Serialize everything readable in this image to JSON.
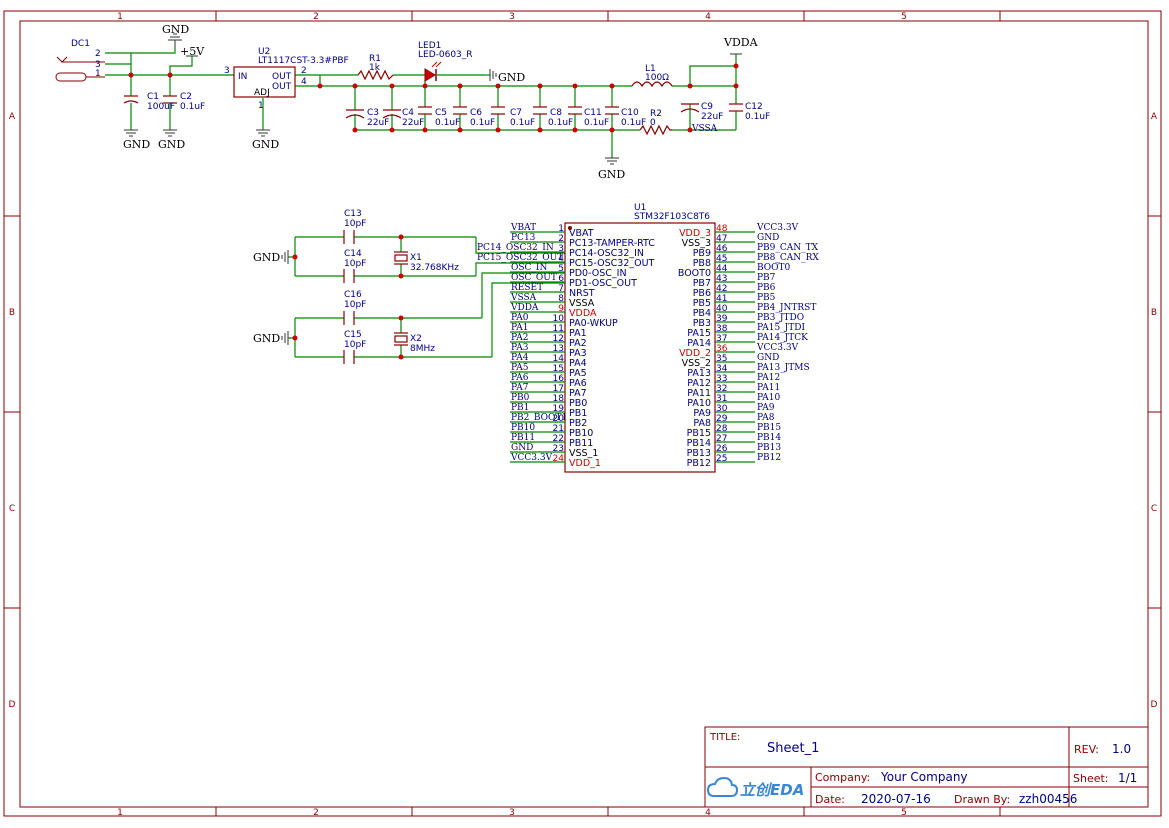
{
  "frame": {
    "columns": [
      "1",
      "2",
      "3",
      "4",
      "5"
    ],
    "rows": [
      "A",
      "B",
      "C",
      "D"
    ]
  },
  "title_block": {
    "title_label": "TITLE:",
    "title": "Sheet_1",
    "rev_label": "REV:",
    "rev": "1.0",
    "company_label": "Company:",
    "company": "Your Company",
    "sheet_label": "Sheet:",
    "sheet": "1/1",
    "date_label": "Date:",
    "date": "2020-07-16",
    "drawn_label": "Drawn By:",
    "drawn": "zzh00456",
    "logo_text": "立创EDA"
  },
  "power": {
    "dc1": {
      "ref": "DC1",
      "pin2": "2",
      "pin3": "3",
      "pin1": "1",
      "sym": "V"
    },
    "gnd": "GND",
    "vcc5": "+5V",
    "vdda": "VDDA",
    "vssa": "VSSA",
    "u2": {
      "ref": "U2",
      "part": "LT1117CST-3.3#PBF",
      "in": "IN",
      "out": "OUT",
      "adj": "ADJ",
      "pin3": "3",
      "pin2": "2",
      "pin4": "4",
      "pin1": "1"
    },
    "r1": {
      "ref": "R1",
      "val": "1k"
    },
    "led1": {
      "ref": "LED1",
      "val": "LED-0603_R"
    },
    "l1": {
      "ref": "L1",
      "val": "100Ω"
    },
    "r2": {
      "ref": "R2",
      "val": "0"
    },
    "caps": [
      {
        "ref": "C1",
        "val": "100uF"
      },
      {
        "ref": "C2",
        "val": "0.1uF"
      },
      {
        "ref": "C3",
        "val": "22uF"
      },
      {
        "ref": "C4",
        "val": "22uF"
      },
      {
        "ref": "C5",
        "val": "0.1uF"
      },
      {
        "ref": "C6",
        "val": "0.1uF"
      },
      {
        "ref": "C7",
        "val": "0.1uF"
      },
      {
        "ref": "C8",
        "val": "0.1uF"
      },
      {
        "ref": "C11",
        "val": "0.1uF"
      },
      {
        "ref": "C10",
        "val": "0.1uF"
      },
      {
        "ref": "C9",
        "val": "22uF"
      },
      {
        "ref": "C12",
        "val": "0.1uF"
      }
    ]
  },
  "osc": {
    "c13": {
      "ref": "C13",
      "val": "10pF"
    },
    "c14": {
      "ref": "C14",
      "val": "10pF"
    },
    "c16": {
      "ref": "C16",
      "val": "10pF"
    },
    "c15": {
      "ref": "C15",
      "val": "10pF"
    },
    "x1": {
      "ref": "X1",
      "val": "32.768KHz"
    },
    "x2": {
      "ref": "X2",
      "val": "8MHz"
    },
    "net_pc14": "PC14_OSC32_IN",
    "net_pc15": "PC15_OSC32_OUT"
  },
  "mcu": {
    "ref": "U1",
    "part": "STM32F103C8T6",
    "left_pins": [
      {
        "num": "1",
        "name": "VBAT",
        "net": "VBAT",
        "red": false
      },
      {
        "num": "2",
        "name": "PC13-TAMPER-RTC",
        "net": "PC13",
        "red": false
      },
      {
        "num": "3",
        "name": "PC14-OSC32_IN",
        "net": "",
        "red": false
      },
      {
        "num": "4",
        "name": "PC15-OSC32_OUT",
        "net": "",
        "red": false
      },
      {
        "num": "5",
        "name": "PD0-OSC_IN",
        "net": "OSC_IN",
        "red": false
      },
      {
        "num": "6",
        "name": "PD1-OSC_OUT",
        "net": "OSC_OUT",
        "red": false
      },
      {
        "num": "7",
        "name": "NRST",
        "net": "RESET",
        "red": false
      },
      {
        "num": "8",
        "name": "VSSA",
        "net": "VSSA",
        "red": false
      },
      {
        "num": "9",
        "name": "VDDA",
        "net": "VDDA",
        "red": true
      },
      {
        "num": "10",
        "name": "PA0-WKUP",
        "net": "PA0",
        "red": false
      },
      {
        "num": "11",
        "name": "PA1",
        "net": "PA1",
        "red": false
      },
      {
        "num": "12",
        "name": "PA2",
        "net": "PA2",
        "red": false
      },
      {
        "num": "13",
        "name": "PA3",
        "net": "PA3",
        "red": false
      },
      {
        "num": "14",
        "name": "PA4",
        "net": "PA4",
        "red": false
      },
      {
        "num": "15",
        "name": "PA5",
        "net": "PA5",
        "red": false
      },
      {
        "num": "16",
        "name": "PA6",
        "net": "PA6",
        "red": false
      },
      {
        "num": "17",
        "name": "PA7",
        "net": "PA7",
        "red": false
      },
      {
        "num": "18",
        "name": "PB0",
        "net": "PB0",
        "red": false
      },
      {
        "num": "19",
        "name": "PB1",
        "net": "PB1",
        "red": false
      },
      {
        "num": "20",
        "name": "PB2",
        "net": "PB2_BOOT1",
        "red": false
      },
      {
        "num": "21",
        "name": "PB10",
        "net": "PB10",
        "red": false
      },
      {
        "num": "22",
        "name": "PB11",
        "net": "PB11",
        "red": false
      },
      {
        "num": "23",
        "name": "VSS_1",
        "net": "GND",
        "red": false
      },
      {
        "num": "24",
        "name": "VDD_1",
        "net": "VCC3.3V",
        "red": true
      }
    ],
    "right_pins": [
      {
        "num": "48",
        "name": "VDD_3",
        "net": "VCC3.3V",
        "red": true
      },
      {
        "num": "47",
        "name": "VSS_3",
        "net": "GND",
        "red": false
      },
      {
        "num": "46",
        "name": "PB9",
        "net": "PB9_CAN_TX",
        "red": false
      },
      {
        "num": "45",
        "name": "PB8",
        "net": "PB8_CAN_RX",
        "red": false
      },
      {
        "num": "44",
        "name": "BOOT0",
        "net": "BOOT0",
        "red": false
      },
      {
        "num": "43",
        "name": "PB7",
        "net": "PB7",
        "red": false
      },
      {
        "num": "42",
        "name": "PB6",
        "net": "PB6",
        "red": false
      },
      {
        "num": "41",
        "name": "PB5",
        "net": "PB5",
        "red": false
      },
      {
        "num": "40",
        "name": "PB4",
        "net": "PB4_JNTRST",
        "red": false
      },
      {
        "num": "39",
        "name": "PB3",
        "net": "PB3_JTDO",
        "red": false
      },
      {
        "num": "38",
        "name": "PA15",
        "net": "PA15_JTDI",
        "red": false
      },
      {
        "num": "37",
        "name": "PA14",
        "net": "PA14_JTCK",
        "red": false
      },
      {
        "num": "36",
        "name": "VDD_2",
        "net": "VCC3.3V",
        "red": true
      },
      {
        "num": "35",
        "name": "VSS_2",
        "net": "GND",
        "red": false
      },
      {
        "num": "34",
        "name": "PA13",
        "net": "PA13_JTMS",
        "red": false
      },
      {
        "num": "33",
        "name": "PA12",
        "net": "PA12",
        "red": false
      },
      {
        "num": "32",
        "name": "PA11",
        "net": "PA11",
        "red": false
      },
      {
        "num": "31",
        "name": "PA10",
        "net": "PA10",
        "red": false
      },
      {
        "num": "30",
        "name": "PA9",
        "net": "PA9",
        "red": false
      },
      {
        "num": "29",
        "name": "PA8",
        "net": "PA8",
        "red": false
      },
      {
        "num": "28",
        "name": "PB15",
        "net": "PB15",
        "red": false
      },
      {
        "num": "27",
        "name": "PB14",
        "net": "PB14",
        "red": false
      },
      {
        "num": "26",
        "name": "PB13",
        "net": "PB13",
        "red": false
      },
      {
        "num": "25",
        "name": "PB12",
        "net": "PB12",
        "red": false
      }
    ]
  },
  "colors": {
    "frame": "#880000",
    "wire": "#008800",
    "part": "#880000",
    "pin_text": "#000080",
    "ref_text": "#000080",
    "net_text": "#000080",
    "power_red": "#cc0000",
    "junction": "#cc0000",
    "logo": "#3a86d6"
  }
}
